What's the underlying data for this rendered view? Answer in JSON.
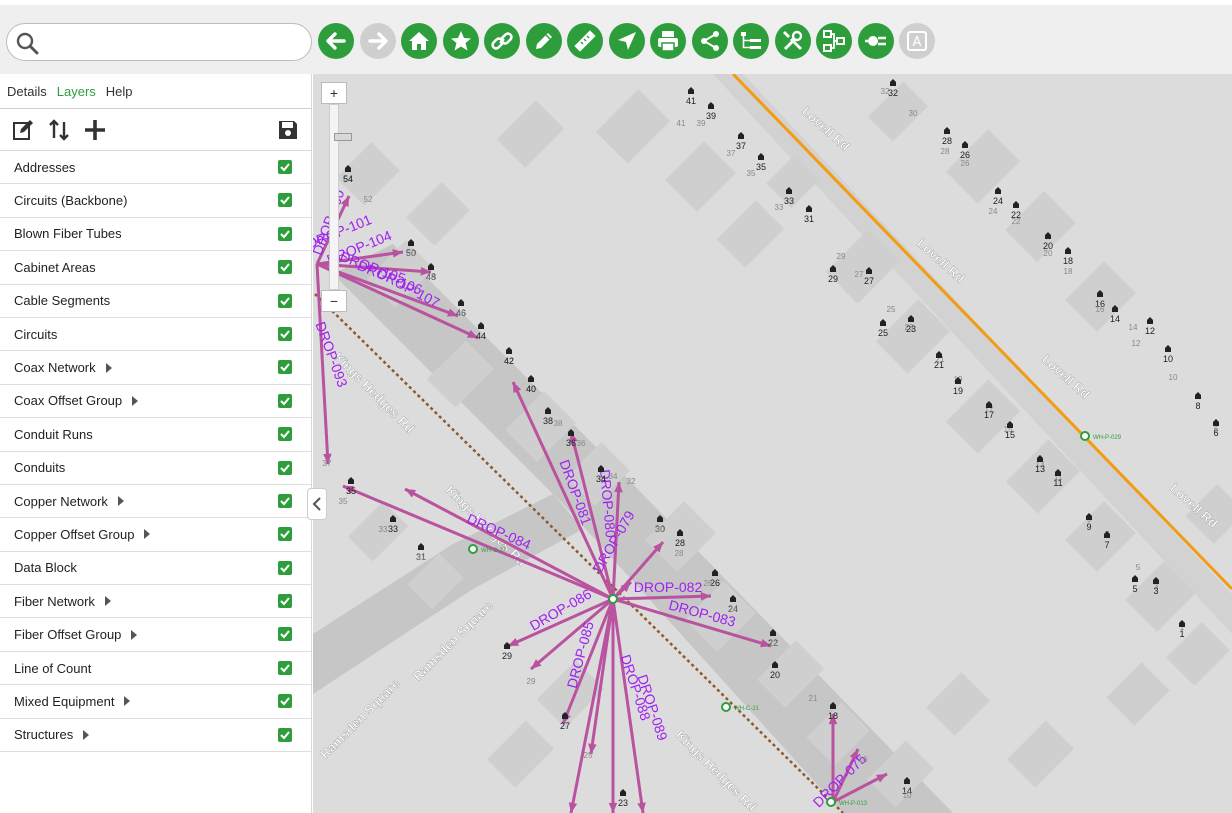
{
  "search": {
    "placeholder": ""
  },
  "toolbar": {
    "buttons": [
      {
        "name": "back-button",
        "icon": "arrow-left-icon",
        "disabled": false
      },
      {
        "name": "forward-button",
        "icon": "arrow-right-icon",
        "disabled": true
      },
      {
        "name": "home-button",
        "icon": "home-icon",
        "disabled": false
      },
      {
        "name": "favorites-button",
        "icon": "star-icon",
        "disabled": false
      },
      {
        "name": "link-button",
        "icon": "link-icon",
        "disabled": false
      },
      {
        "name": "edit-button",
        "icon": "pencil-icon",
        "disabled": false
      },
      {
        "name": "measure-button",
        "icon": "ruler-icon",
        "disabled": false
      },
      {
        "name": "navigate-button",
        "icon": "location-arrow-icon",
        "disabled": false
      },
      {
        "name": "print-button",
        "icon": "printer-icon",
        "disabled": false
      },
      {
        "name": "share-button",
        "icon": "share-icon",
        "disabled": false
      },
      {
        "name": "tree-button",
        "icon": "tree-list-icon",
        "disabled": false
      },
      {
        "name": "tools-button",
        "icon": "tools-icon",
        "disabled": false
      },
      {
        "name": "network-button",
        "icon": "network-icon",
        "disabled": false
      },
      {
        "name": "connect-button",
        "icon": "plug-icon",
        "disabled": false
      },
      {
        "name": "annotate-button",
        "icon": "text-edit-icon",
        "disabled": true
      }
    ]
  },
  "panel": {
    "tabs": [
      {
        "label": "Details",
        "active": false
      },
      {
        "label": "Layers",
        "active": true
      },
      {
        "label": "Help",
        "active": false
      }
    ],
    "layers": [
      {
        "label": "Addresses",
        "expandable": false,
        "checked": true
      },
      {
        "label": "Circuits (Backbone)",
        "expandable": false,
        "checked": true
      },
      {
        "label": "Blown Fiber Tubes",
        "expandable": false,
        "checked": true
      },
      {
        "label": "Cabinet Areas",
        "expandable": false,
        "checked": true
      },
      {
        "label": "Cable Segments",
        "expandable": false,
        "checked": true
      },
      {
        "label": "Circuits",
        "expandable": false,
        "checked": true
      },
      {
        "label": "Coax Network",
        "expandable": true,
        "checked": true
      },
      {
        "label": "Coax Offset Group",
        "expandable": true,
        "checked": true
      },
      {
        "label": "Conduit Runs",
        "expandable": false,
        "checked": true
      },
      {
        "label": "Conduits",
        "expandable": false,
        "checked": true
      },
      {
        "label": "Copper Network",
        "expandable": true,
        "checked": true
      },
      {
        "label": "Copper Offset Group",
        "expandable": true,
        "checked": true
      },
      {
        "label": "Data Block",
        "expandable": false,
        "checked": true
      },
      {
        "label": "Fiber Network",
        "expandable": true,
        "checked": true
      },
      {
        "label": "Fiber Offset Group",
        "expandable": true,
        "checked": true
      },
      {
        "label": "Line of Count",
        "expandable": false,
        "checked": true
      },
      {
        "label": "Mixed Equipment",
        "expandable": true,
        "checked": true
      },
      {
        "label": "Structures",
        "expandable": true,
        "checked": true
      }
    ]
  },
  "map": {
    "zoom_in_label": "+",
    "zoom_out_label": "−",
    "zoom_level_value": 0.15,
    "colors": {
      "road": "#c6c6c6",
      "building": "#cfcfcf",
      "drop": "#b9529f",
      "drop_label": "#a020f0",
      "main_road": "#f39c12",
      "duct": "#8b5a2b",
      "marker": "#2e9e3c"
    },
    "street_labels": [
      "Lovell Rd",
      "Lovell Rd",
      "Lovell Rd",
      "Lovell Rd",
      "Kings Hedges Rd",
      "Kings Hedges Rd",
      "Kings Hedges Rd",
      "Ramsden Square",
      "Ramsden Square"
    ],
    "drop_labels": [
      "DROP-100",
      "DROP-101",
      "DROP-104",
      "DROP-105",
      "DROP-106",
      "DROP-107",
      "DROP-093",
      "DROP-081",
      "DROP-080",
      "DROP-079",
      "DROP-084",
      "DROP-082",
      "DROP-083",
      "DROP-086",
      "DROP-085",
      "DROP-088",
      "DROP-089",
      "DROP-075"
    ],
    "nodes": [
      "WH-P-029",
      "WH-C-27",
      "WH-C-21",
      "WH-P-013"
    ],
    "house_numbers": [
      "41",
      "41",
      "39",
      "39",
      "37",
      "37",
      "35",
      "35",
      "33",
      "33",
      "31",
      "32",
      "32",
      "30",
      "28",
      "28",
      "26",
      "26",
      "24",
      "24",
      "22",
      "22",
      "20",
      "20",
      "18",
      "18",
      "16",
      "16",
      "14",
      "14",
      "12",
      "12",
      "10",
      "10",
      "8",
      "6",
      "6",
      "29",
      "29",
      "27",
      "27",
      "25",
      "25",
      "23",
      "23",
      "21",
      "21",
      "19",
      "19",
      "17",
      "17",
      "15",
      "15",
      "13",
      "13",
      "11",
      "11",
      "9",
      "9",
      "7",
      "7",
      "5",
      "5",
      "3",
      "3",
      "1",
      "1",
      "54",
      "54",
      "52",
      "50",
      "50",
      "48",
      "48",
      "46",
      "46",
      "44",
      "42",
      "42",
      "40",
      "40",
      "38",
      "38",
      "36",
      "36",
      "34",
      "34",
      "32",
      "30",
      "30",
      "28",
      "28",
      "26",
      "26",
      "24",
      "24",
      "22",
      "22",
      "20",
      "37",
      "35",
      "35",
      "33",
      "33",
      "31",
      "31",
      "29",
      "29",
      "27",
      "25",
      "23",
      "21",
      "18",
      "16",
      "14",
      "10",
      "10"
    ]
  }
}
